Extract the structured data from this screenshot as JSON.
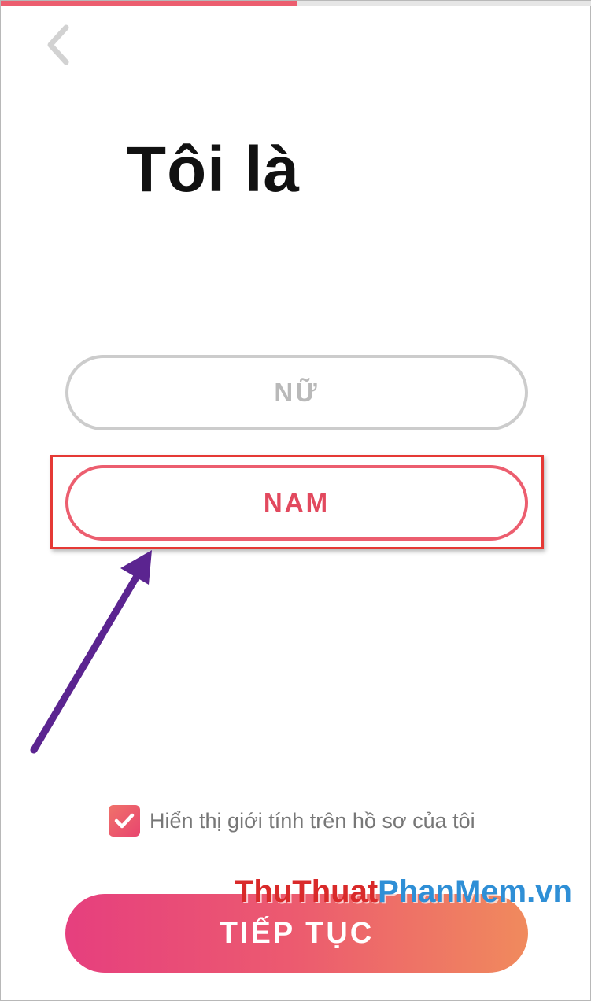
{
  "progress": {
    "value": 0.5,
    "color": "#ec5e6f"
  },
  "header": {
    "back_icon": "chevron-left-icon"
  },
  "title": "Tôi là",
  "options": [
    {
      "label": "NỮ",
      "selected": false
    },
    {
      "label": "NAM",
      "selected": true
    }
  ],
  "show_gender": {
    "label": "Hiển thị giới tính trên hồ sơ của tôi",
    "checked": true
  },
  "continue_label": "TIẾP TỤC",
  "watermark": {
    "part1": "ThuThuat",
    "part2": "PhanMem",
    "part3": ".vn"
  },
  "colors": {
    "accent": "#ec5e6f",
    "annotation_box": "#e53935",
    "annotation_arrow": "#5b2490",
    "gradient_start": "#e63f7e",
    "gradient_end": "#f08a5d"
  }
}
